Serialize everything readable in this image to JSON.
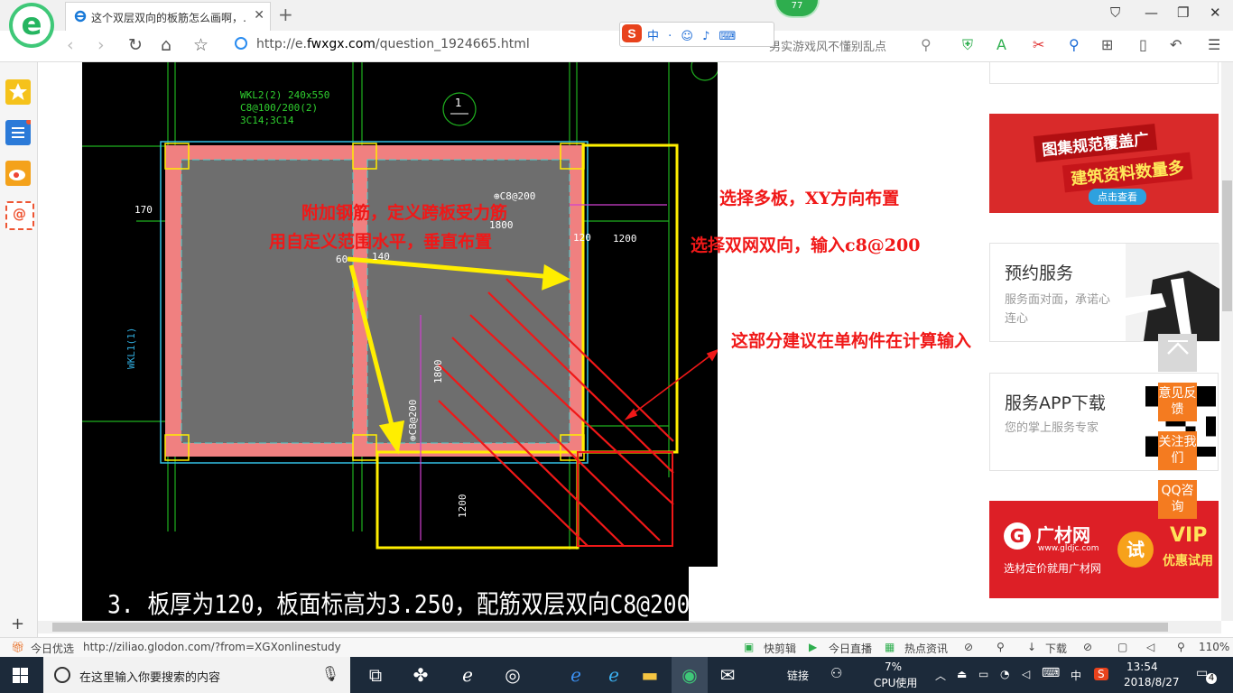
{
  "browser": {
    "tab_title": "这个双层双向的板筋怎么画啊，…",
    "address": "http://e.fwxgx.com/question_1924665.html",
    "address_prefix": "http://e.",
    "address_domain": "fwxgx.com",
    "address_path": "/question_1924665.html",
    "search_hint": "男实游戏风不懂别乱点",
    "badge_count": "77",
    "ime_label": "中 · ☺ ♪ ⌨"
  },
  "annotations": {
    "left_1": "附加钢筋，定义跨板受力筋",
    "left_2": "用自定义范围水平，垂直布置",
    "right_1": "选择多板，XY方向布置",
    "right_2": "选择双网双向，输入c8@200",
    "right_3": "这部分建议在单构件在计算输入"
  },
  "cad": {
    "beam_label_1": "WKL2(2) 240x550",
    "beam_label_2": "C8@100/200(2)",
    "beam_label_3": "3C14;3C14",
    "axis_mark": "1",
    "dim_170": "170",
    "dim_1200_right": "1200",
    "dim_1800_h": "1800",
    "dim_1800_v": "1800",
    "dim_1200_bottom": "1200",
    "rebar_top": "⊕C8@200",
    "rebar_vert": "⊕C8@200",
    "small_60": "60",
    "small_140": "140",
    "small_120": "120",
    "wkl1": "WKL1(1)",
    "bottom_note": "3. 板厚为120，板面标高为3.250，配筋双层双向C8@200。"
  },
  "right_panel": {
    "ad1_line1": "图集规范覆盖广",
    "ad1_line2": "建筑资料数量多",
    "ad1_btn": "点击查看",
    "service_title": "预约服务",
    "service_sub": "服务面对面，承诺心连心",
    "app_title": "服务APP下载",
    "app_sub": "您的掌上服务专家",
    "ad2_brand": "广材网",
    "ad2_url": "www.gldjc.com",
    "ad2_slogan": "选材定价就用广材网",
    "ad2_try": "试",
    "ad2_vip": "VIP",
    "ad2_vip_sub": "优惠试用",
    "float_feedback": "意见反馈",
    "float_follow": "关注我们",
    "float_qq": "QQ咨询"
  },
  "statusbar": {
    "left_label": "今日优选",
    "url": "http://ziliao.glodon.com/?from=XGXonlinestudy",
    "clip": "快剪辑",
    "live": "今日直播",
    "news": "热点资讯",
    "download": "下载",
    "zoom": "110%"
  },
  "taskbar": {
    "search_placeholder": "在这里输入你要搜索的内容",
    "link_label": "链接",
    "cpu_pct": "7%",
    "cpu_label": "CPU使用",
    "ime": "中",
    "time": "13:54",
    "date": "2018/8/27",
    "notif_count": "4"
  },
  "colors": {
    "accent_green": "#25b560",
    "annotation_red": "#f01818",
    "cad_yellow": "#ffee00",
    "float_orange": "#f47b20",
    "taskbar": "#1c2a3a"
  }
}
